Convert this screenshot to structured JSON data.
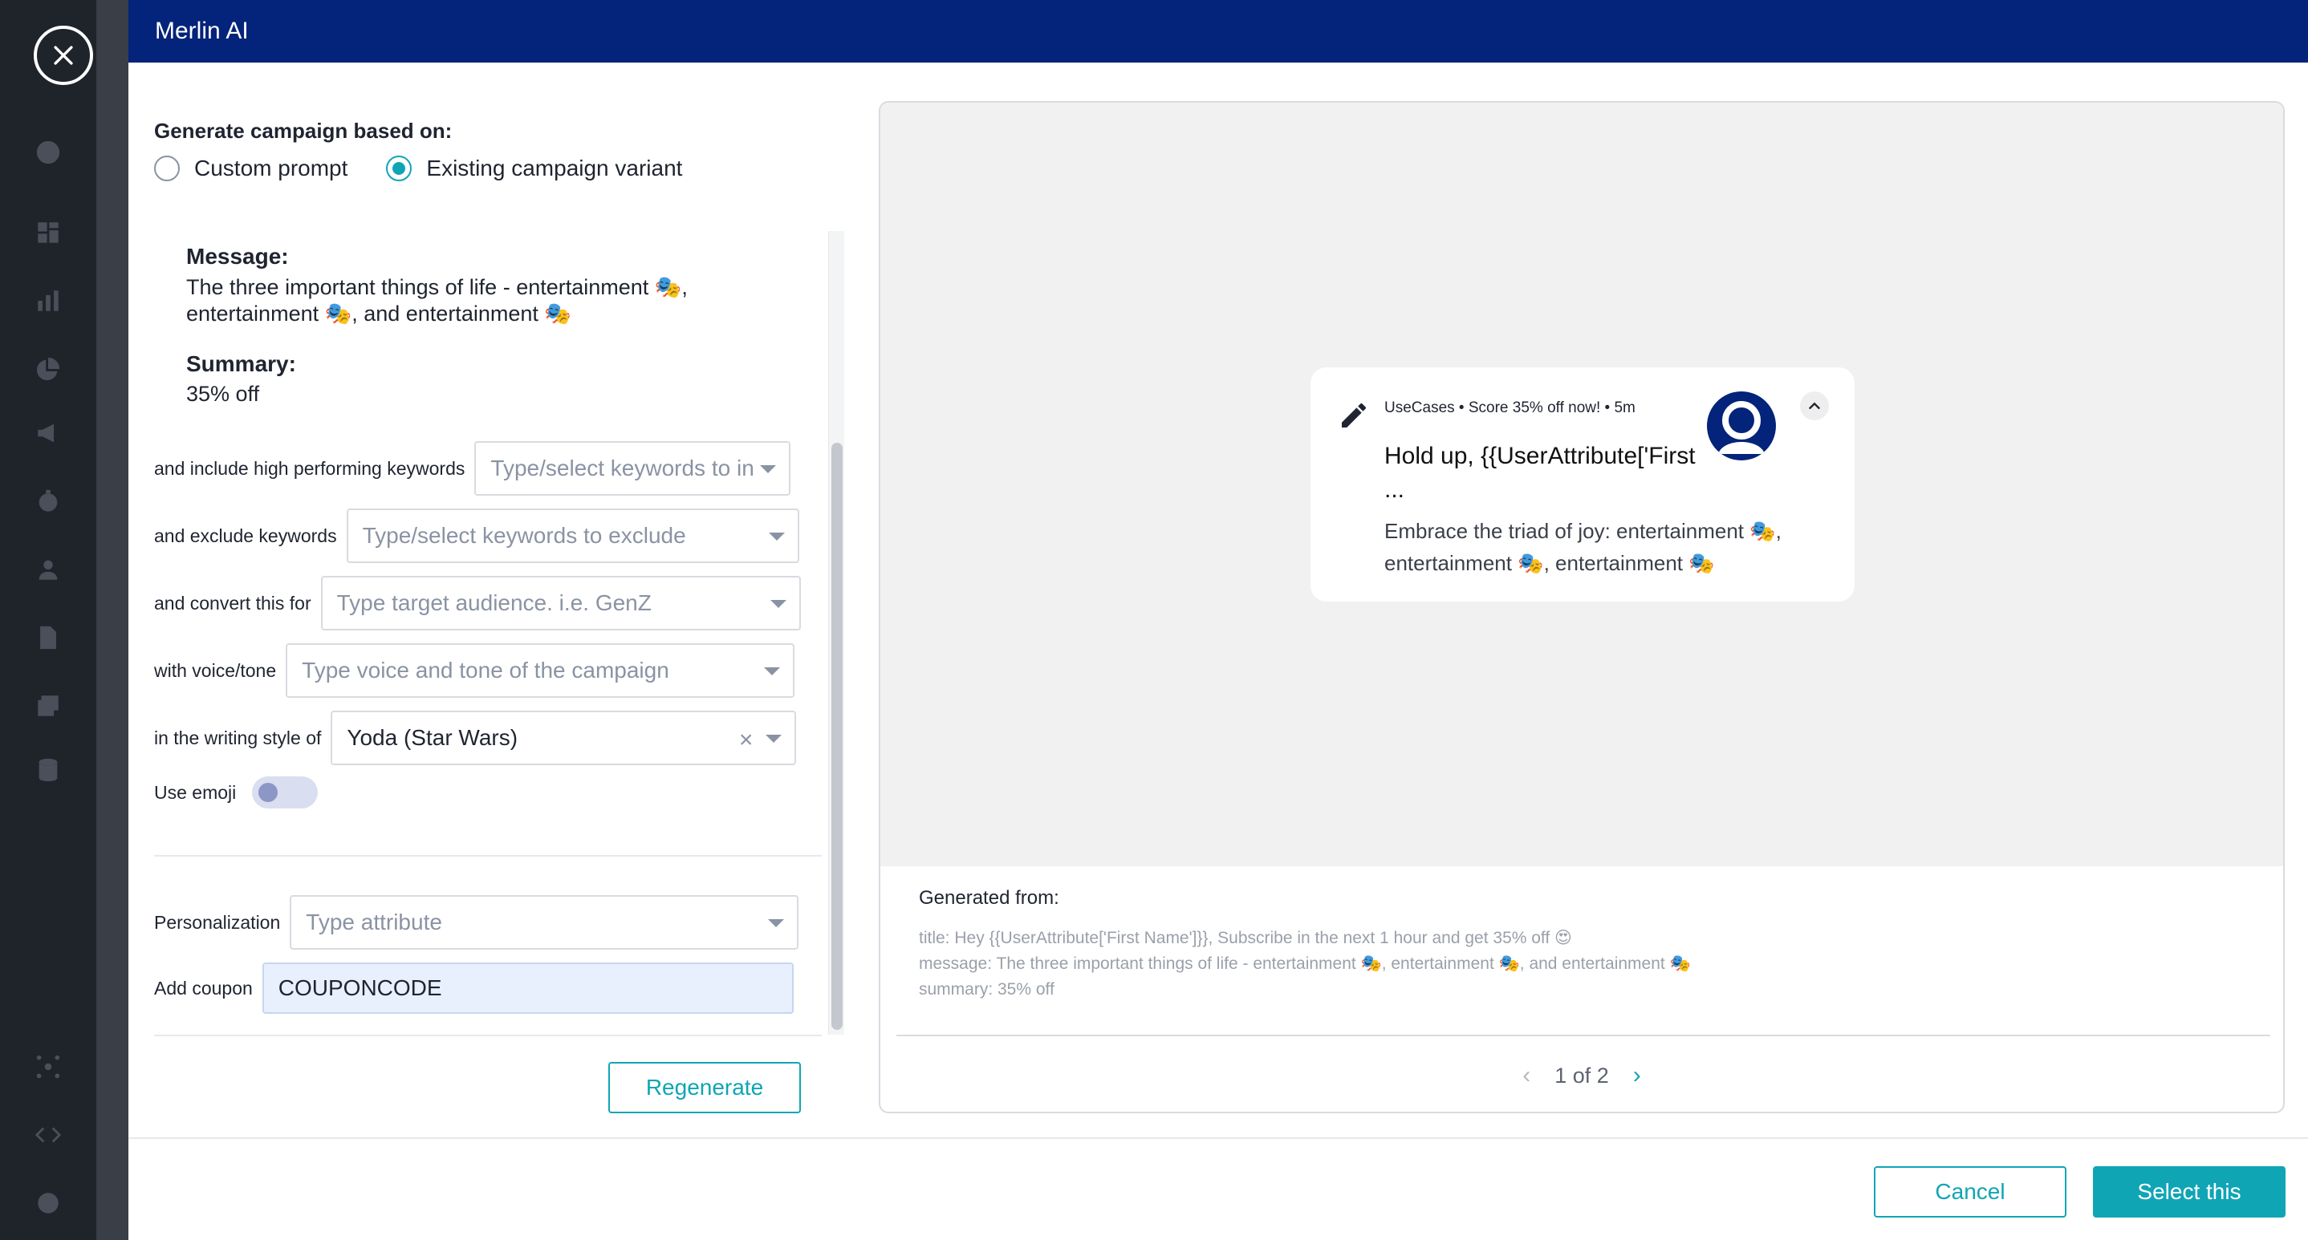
{
  "modal": {
    "title": "Merlin AI"
  },
  "generate": {
    "label": "Generate campaign based on:",
    "options": [
      {
        "label": "Custom prompt",
        "selected": false
      },
      {
        "label": "Existing campaign variant",
        "selected": true
      }
    ]
  },
  "variant": {
    "message_label": "Message:",
    "message": "The three important things of life - entertainment 🎭, entertainment 🎭, and entertainment 🎭",
    "summary_label": "Summary:",
    "summary": "35% off"
  },
  "form": {
    "include_keywords": {
      "label": "and include high performing keywords",
      "placeholder": "Type/select keywords to in"
    },
    "exclude_keywords": {
      "label": "and exclude keywords",
      "placeholder": "Type/select keywords to exclude"
    },
    "audience": {
      "label": "and convert this for",
      "placeholder": "Type target audience. i.e. GenZ"
    },
    "voice_tone": {
      "label": "with voice/tone",
      "placeholder": "Type voice and tone of the campaign"
    },
    "writing_style": {
      "label": "in the writing style of",
      "value": "Yoda (Star Wars)"
    },
    "use_emoji": {
      "label": "Use emoji",
      "enabled": false
    },
    "personalization": {
      "label": "Personalization",
      "placeholder": "Type attribute"
    },
    "coupon": {
      "label": "Add coupon",
      "value": "COUPONCODE"
    }
  },
  "buttons": {
    "regenerate": "Regenerate",
    "cancel": "Cancel",
    "select": "Select this"
  },
  "preview": {
    "notification": {
      "meta": "UseCases • Score 35% off now! • 5m",
      "title": "Hold up, {{UserAttribute['First ...",
      "body": "Embrace the triad of joy: entertainment 🎭, entertainment 🎭, entertainment 🎭"
    },
    "generated_from_label": "Generated from:",
    "generated_from": {
      "title": "title: Hey {{UserAttribute['First Name']}}, Subscribe in the next 1 hour and get 35% off 😍",
      "message": "message: The three important things of life - entertainment 🎭, entertainment 🎭, and entertainment 🎭",
      "summary": "summary: 35% off"
    },
    "pager": {
      "text": "1 of 2"
    }
  },
  "colors": {
    "header": "#04237a",
    "accent": "#10a5b5"
  }
}
